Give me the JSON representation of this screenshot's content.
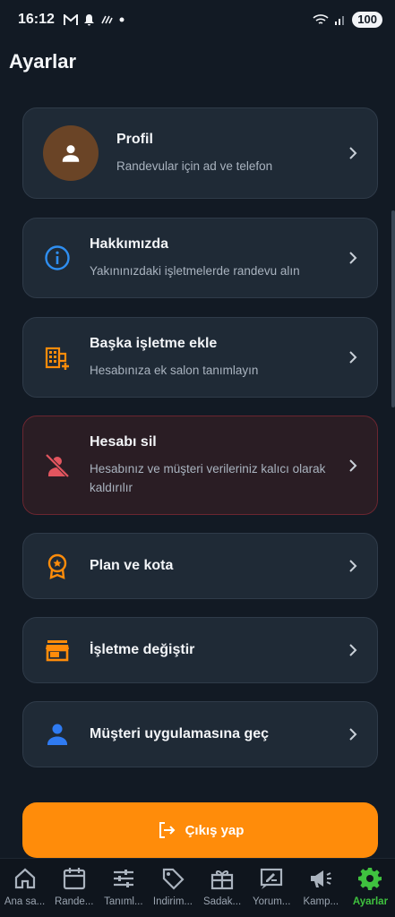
{
  "status": {
    "time": "16:12",
    "battery": "100"
  },
  "page_title": "Ayarlar",
  "cards": [
    {
      "title": "Profil",
      "subtitle": "Randevular için ad ve telefon"
    },
    {
      "title": "Hakkımızda",
      "subtitle": "Yakınınızdaki işletmelerde randevu alın"
    },
    {
      "title": "Başka işletme ekle",
      "subtitle": "Hesabınıza ek salon tanımlayın"
    },
    {
      "title": "Hesabı sil",
      "subtitle": "Hesabınız ve müşteri verileriniz kalıcı olarak kaldırılır"
    },
    {
      "title": "Plan ve kota",
      "subtitle": ""
    },
    {
      "title": "İşletme değiştir",
      "subtitle": ""
    },
    {
      "title": "Müşteri uygulamasına geç",
      "subtitle": ""
    }
  ],
  "logout_label": "Çıkış yap",
  "nav": [
    {
      "label": "Ana sa...",
      "icon": "home-icon"
    },
    {
      "label": "Rande...",
      "icon": "calendar-icon"
    },
    {
      "label": "Tanıml...",
      "icon": "sliders-icon"
    },
    {
      "label": "İndirim...",
      "icon": "tag-icon"
    },
    {
      "label": "Sadak...",
      "icon": "gift-icon"
    },
    {
      "label": "Yorum...",
      "icon": "review-icon"
    },
    {
      "label": "Kamp...",
      "icon": "megaphone-icon"
    },
    {
      "label": "Ayarlar",
      "icon": "gear-icon"
    }
  ],
  "colors": {
    "accent": "#ff8c0a",
    "active_nav": "#3fc23f",
    "danger": "#e2555f",
    "info": "#2f8ff2",
    "user_blue": "#2f7bf2"
  }
}
